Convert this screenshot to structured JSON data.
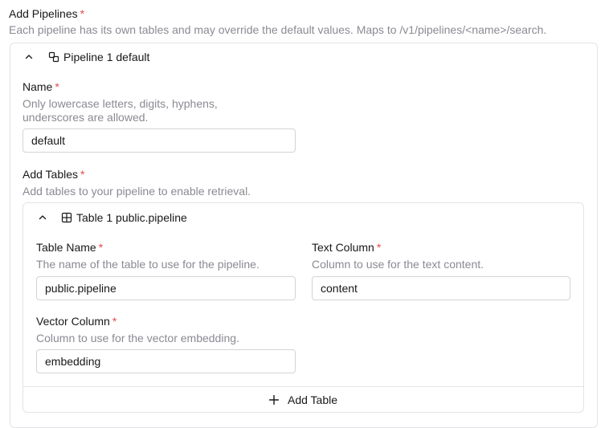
{
  "pipelines": {
    "label": "Add Pipelines",
    "required_mark": "*",
    "description": "Each pipeline has its own tables and may override the default values. Maps to /v1/pipelines/<name>/search.",
    "items": [
      {
        "header_label": "Pipeline 1",
        "header_name": "default",
        "name_field": {
          "label": "Name",
          "required_mark": "*",
          "description_line1": "Only lowercase letters, digits, hyphens,",
          "description_line2": "underscores are allowed.",
          "value": "default"
        },
        "tables": {
          "label": "Add Tables",
          "required_mark": "*",
          "description": "Add tables to your pipeline to enable retrieval.",
          "items": [
            {
              "header_label": "Table 1",
              "header_name": "public.pipeline",
              "table_name": {
                "label": "Table Name",
                "required_mark": "*",
                "description": "The name of the table to use for the pipeline.",
                "value": "public.pipeline"
              },
              "text_column": {
                "label": "Text Column",
                "required_mark": "*",
                "description": "Column to use for the text content.",
                "value": "content"
              },
              "vector_column": {
                "label": "Vector Column",
                "required_mark": "*",
                "description": "Column to use for the vector embedding.",
                "value": "embedding"
              }
            }
          ],
          "add_label": "Add Table"
        }
      }
    ]
  },
  "icons": {
    "collapse": "chevron-up-icon",
    "pipeline": "pipeline-icon",
    "table": "table-icon",
    "add": "plus-icon"
  },
  "colors": {
    "required": "#e5484d",
    "muted_text": "#8a8a93",
    "border": "#e4e4e7"
  }
}
